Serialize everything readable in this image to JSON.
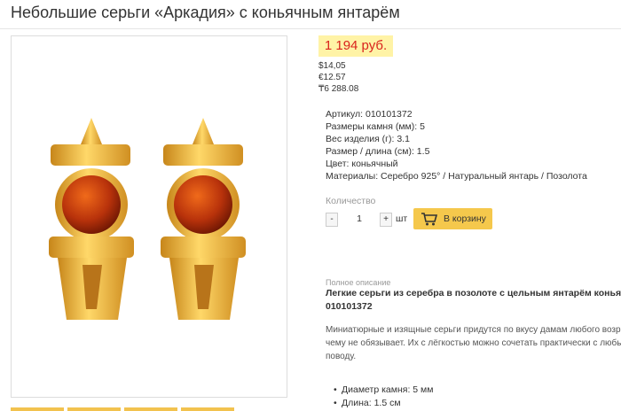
{
  "product": {
    "title": "Небольшие серьги «Аркадия» с коньячным янтарём",
    "price": "1 194 руб.",
    "alt_prices": [
      "$14,05",
      "€12.57",
      "₸6 288.08"
    ],
    "specs": [
      "Артикул: 010101372",
      "Размеры камня (мм): 5",
      "Вес изделия (г): 3.1",
      "Размер / длина (см): 1.5",
      "Цвет: коньячный",
      "Материалы: Серебро 925° / Натуральный янтарь / Позолота"
    ]
  },
  "colors": {
    "accent": "#f5c84c",
    "price_bg": "#fff3a6",
    "price_text": "#d9231d"
  },
  "quantity": {
    "label": "Количество",
    "minus": "-",
    "value": "1",
    "plus": "+",
    "unit": "шт",
    "cart_label": "В корзину",
    "cart_icon": "cart-icon"
  },
  "description": {
    "label": "Полное описание",
    "title_lines": [
      "Легкие серьги из серебра в позолоте с цельным янтарём коньяч",
      "010101372"
    ],
    "body_lines": [
      "Миниатюрные и изящные серьги придутся по вкусу дамам любого возраста, в",
      "чему не обязывает. Их с лёгкостью можно сочетать практически с любым стил",
      "поводу."
    ],
    "bullets": [
      "Диаметр камня: 5 мм",
      "Длина: 1.5 см"
    ]
  }
}
